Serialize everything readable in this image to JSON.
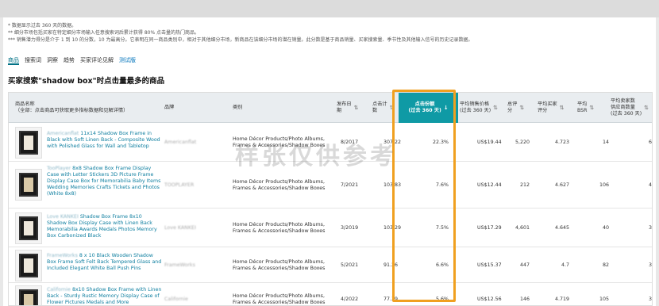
{
  "notes": [
    "* 数据显示过去 360 天的数据。",
    "** 细分市场包括买家在特定细分市场输入任意搜索词后累计获得 80% 点击量的热门商品。",
    "*** 销售潜力得分是介于 1 到 10 的分数，10 为最高分。它表明在同一商品类别中，相对于其他细分市场，新商品在该细分市场的潜在销量。此分数是基于商品销量、买家搜索量、季节性及其他输入信号的历史记录数据。"
  ],
  "tabs": [
    {
      "label": "商品",
      "active": true
    },
    {
      "label": "搜索词",
      "active": false
    },
    {
      "label": "洞察",
      "active": false
    },
    {
      "label": "趋势",
      "active": false
    },
    {
      "label": "买家评论见解",
      "active": false
    },
    {
      "label": "测试版",
      "active": false
    }
  ],
  "section_title": "买家搜索\"shadow box\"时点击量最多的商品",
  "columns": [
    {
      "label": "商品名称\n（全部：点击商品可获取更多指标数据和见解详情）",
      "sort": false
    },
    {
      "label": "品牌",
      "sort": false
    },
    {
      "label": "类别",
      "sort": false
    },
    {
      "label": "发布日\n期",
      "sort": true
    },
    {
      "label": "点击计\n数",
      "sort": true
    },
    {
      "label": "点击份额\n(过去 360 天)",
      "sort": true
    },
    {
      "label": "平均销售价格\n(过去 360 天)",
      "sort": true
    },
    {
      "label": "总评\n分",
      "sort": true
    },
    {
      "label": "平均买家\n评分",
      "sort": true
    },
    {
      "label": "平均\nBSR",
      "sort": true
    },
    {
      "label": "平均卖家数\n供应商数量\n(过去 360 天)",
      "sort": true
    }
  ],
  "rows": [
    {
      "brand_prefix": "Americanflat",
      "name": "11x14 Shadow Box Frame in Black with Soft Linen Back - Composite Wood with Polished Glass for Wall and Tabletop",
      "brand": "Americanflat",
      "category": "Home Décor Products/Photo Albums, Frames & Accessories/Shadow Boxes",
      "date": "8/2017",
      "clicks": "307.22",
      "share": "22.3%",
      "price": "US$19.44",
      "ratings": "5,220",
      "stars": "4.723",
      "bsr": "14",
      "sellers": "6"
    },
    {
      "brand_prefix": "TooPlayer",
      "name": "8x8 Shadow Box Frame Display Case with Letter Stickers 3D Picture Frame Display Case Box for Memorabilia Baby Items Wedding Memories Crafts Tickets and Photos (White 8x8)",
      "brand": "TOOPLAYER",
      "category": "Home Décor Products/Photo Albums, Frames & Accessories/Shadow Boxes",
      "date": "7/2021",
      "clicks": "103.83",
      "share": "7.6%",
      "price": "US$12.44",
      "ratings": "212",
      "stars": "4.627",
      "bsr": "106",
      "sellers": "4"
    },
    {
      "brand_prefix": "Love KANKEI",
      "name": "Shadow Box Frame 8x10 Shadow Box Display Case with Linen Back Memorabilia Awards Medals Photos Memory Box Carbonized Black",
      "brand": "Love KANKEI",
      "category": "Home Décor Products/Photo Albums, Frames & Accessories/Shadow Boxes",
      "date": "3/2019",
      "clicks": "103.29",
      "share": "7.5%",
      "price": "US$17.29",
      "ratings": "4,601",
      "stars": "4.645",
      "bsr": "40",
      "sellers": "3"
    },
    {
      "brand_prefix": "FrameWorks",
      "name": "8 x 10 Black Wooden Shadow Box Frame Soft Felt Back Tempered Glass and Included Elegant White Ball Push Pins",
      "brand": "FrameWorks",
      "category": "Home Décor Products/Photo Albums, Frames & Accessories/Shadow Boxes",
      "date": "5/2021",
      "clicks": "91.26",
      "share": "6.6%",
      "price": "US$15.37",
      "ratings": "447",
      "stars": "4.7",
      "bsr": "82",
      "sellers": "3"
    },
    {
      "brand_prefix": "Californie",
      "name": "8x10 Shadow Box Frame with Linen Back - Sturdy Rustic Memory Display Case of Flower Pictures Medals and More",
      "brand": "Californie",
      "category": "Home Décor Products/Photo Albums, Frames & Accessories/Shadow Boxes",
      "date": "4/2022",
      "clicks": "77.39",
      "share": "5.6%",
      "price": "US$12.56",
      "ratings": "146",
      "stars": "4.719",
      "bsr": "105",
      "sellers": "3"
    }
  ],
  "watermark": "样张仅供参考",
  "accent_color": "#0f9aa5",
  "highlight_color": "#f0a020"
}
